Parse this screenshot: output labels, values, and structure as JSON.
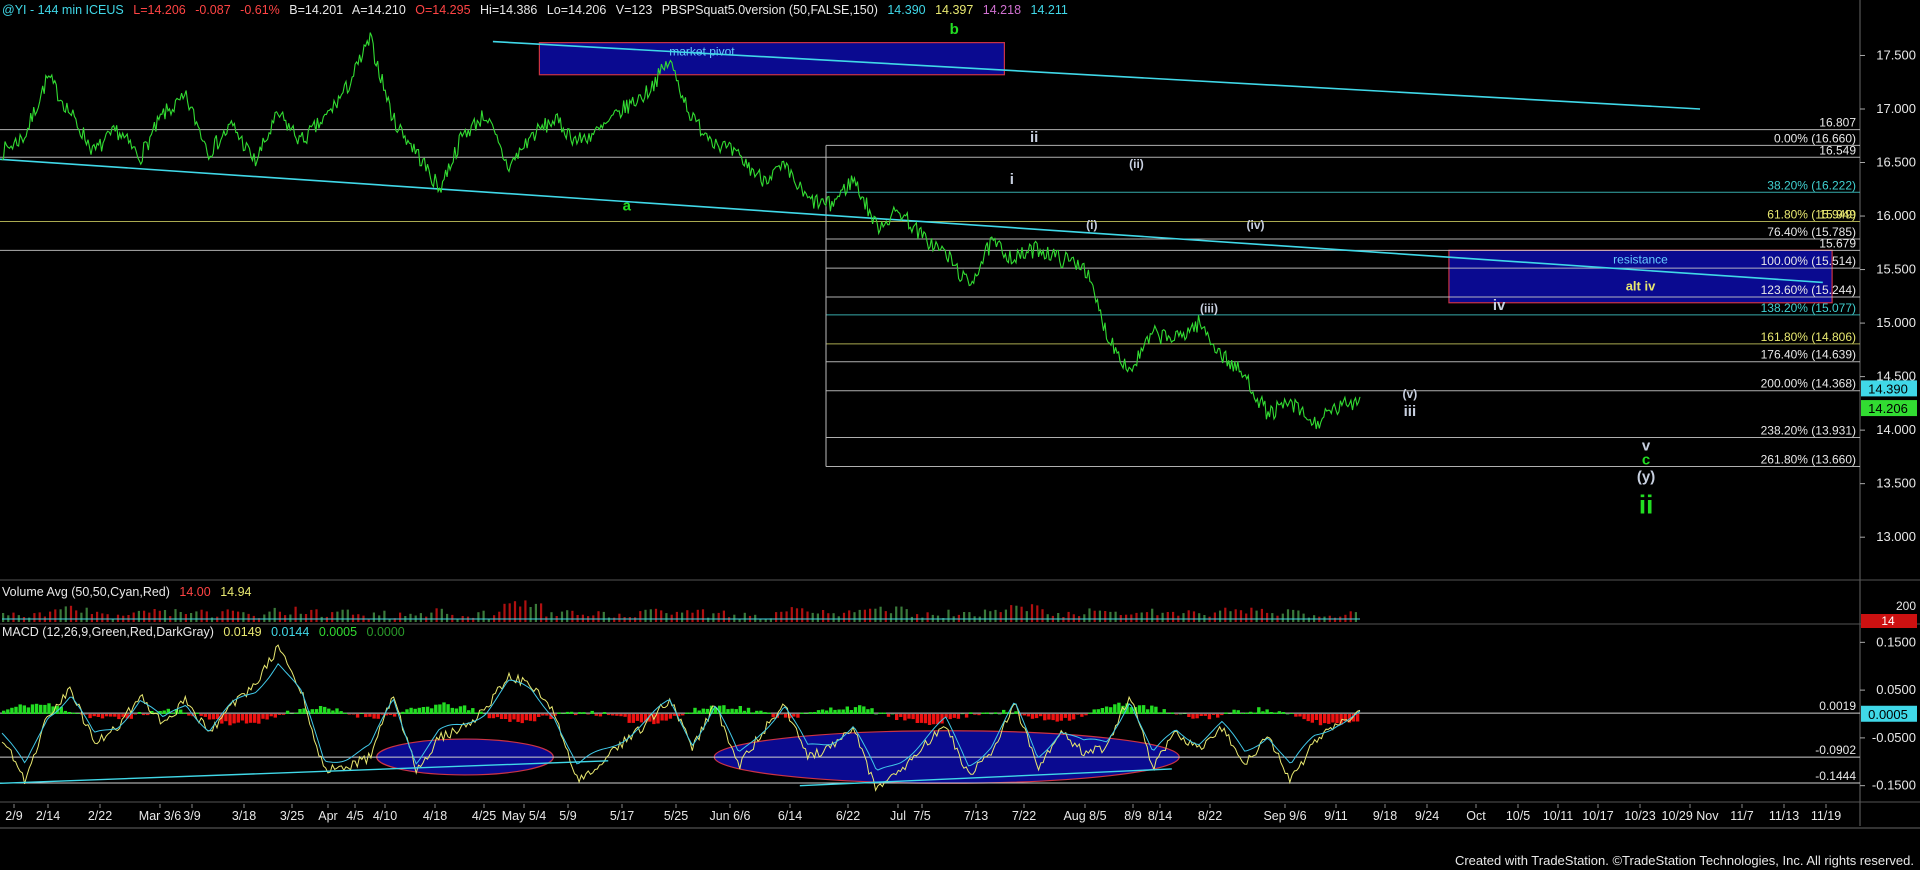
{
  "header": {
    "symbol": "@YI - 144 min ICEUS",
    "last": "L=14.206",
    "change": "-0.087",
    "pct": "-0.61%",
    "bid": "B=14.201",
    "ask": "A=14.210",
    "open": "O=14.295",
    "high": "Hi=14.386",
    "low": "Lo=14.206",
    "vol": "V=123",
    "study": "PBSPSquat5.0version (50,FALSE,150)",
    "v1": "14.390",
    "v2": "14.397",
    "v3": "14.218",
    "v4": "14.211"
  },
  "volume_label": {
    "name": "Volume Avg (50,50,Cyan,Red)",
    "a": "14.00",
    "b": "14.94"
  },
  "macd_label": {
    "name": "MACD (12,26,9,Green,Red,DarkGray)",
    "a": "0.0149",
    "b": "0.0144",
    "c": "0.0005",
    "d": "0.0000"
  },
  "footer": "Created with TradeStation. ©TradeStation Technologies, Inc. All rights reserved.",
  "colors": {
    "price": "#32dc32",
    "cyan": "#40d8e8",
    "box": "#0a0a90",
    "boxBorder": "#cc3344",
    "fib": "#ffffff",
    "fibGold": "#e8e870",
    "green": "#22dd22",
    "red": "#ee1111"
  },
  "chart_data": [
    {
      "type": "line",
      "title": "@YI - 144 min ICEUS",
      "ylim": [
        12.6,
        17.85
      ],
      "y_ticks": [
        "17.500",
        "17.000",
        "16.500",
        "16.000",
        "15.500",
        "15.000",
        "14.500",
        "14.000",
        "13.500",
        "13.000"
      ],
      "y_tick_values": [
        17.5,
        17.0,
        16.5,
        16.0,
        15.5,
        15.0,
        14.5,
        14.0,
        13.5,
        13.0
      ],
      "x_ticks": [
        "2/9",
        "2/14",
        "2/22",
        "Mar 3/6",
        "3/9",
        "3/18",
        "3/25",
        "Apr",
        "4/5",
        "4/10",
        "4/18",
        "4/25",
        "May 5/4",
        "5/9",
        "5/17",
        "5/25",
        "Jun 6/6",
        "6/14",
        "6/22",
        "Jul",
        "7/5",
        "7/13",
        "7/22",
        "Aug 8/5",
        "8/9",
        "8/14",
        "8/22",
        "Sep 9/6",
        "9/11",
        "9/18",
        "9/24",
        "Oct",
        "10/5",
        "10/11",
        "10/17",
        "10/23",
        "10/29 Nov",
        "11/7",
        "11/13",
        "11/19"
      ],
      "series": [
        {
          "values": [
            16.6,
            16.75,
            17.3,
            16.95,
            16.6,
            16.8,
            16.55,
            16.95,
            17.1,
            16.6,
            16.85,
            16.5,
            16.95,
            16.7,
            16.9,
            17.2,
            17.65,
            16.9,
            16.6,
            16.25,
            16.75,
            16.95,
            16.45,
            16.75,
            16.9,
            16.7,
            16.8,
            17.0,
            17.15,
            17.45,
            16.9,
            16.7,
            16.55,
            16.35,
            16.45,
            16.15,
            16.1,
            16.35,
            15.9,
            16.05,
            15.8,
            15.65,
            15.35,
            15.75,
            15.6,
            15.7,
            15.6,
            15.55,
            14.9,
            14.55,
            14.9,
            14.85,
            15.0,
            14.7,
            14.5,
            14.15,
            14.25,
            14.05,
            14.2,
            14.3
          ]
        }
      ],
      "fib_levels": [
        {
          "label": "16.807",
          "value": 16.807,
          "style": "white"
        },
        {
          "label": "0.00% (16.660)",
          "value": 16.66,
          "style": "white"
        },
        {
          "label": "16.549",
          "value": 16.549,
          "style": "white"
        },
        {
          "label": "38.20% (16.222)",
          "value": 16.222,
          "style": "cyan"
        },
        {
          "label": "61.80% (15.949)",
          "value": 15.949,
          "style": "gold"
        },
        {
          "label": "15.949",
          "value": 15.949,
          "style": "gold"
        },
        {
          "label": "76.40% (15.785)",
          "value": 15.785,
          "style": "white"
        },
        {
          "label": "15.679",
          "value": 15.679,
          "style": "white"
        },
        {
          "label": "100.00% (15.514)",
          "value": 15.514,
          "style": "white"
        },
        {
          "label": "123.60% (15.244)",
          "value": 15.244,
          "style": "white"
        },
        {
          "label": "138.20% (15.077)",
          "value": 15.077,
          "style": "cyan"
        },
        {
          "label": "161.80% (14.806)",
          "value": 14.806,
          "style": "gold"
        },
        {
          "label": "176.40% (14.639)",
          "value": 14.639,
          "style": "white"
        },
        {
          "label": "200.00% (14.368)",
          "value": 14.368,
          "style": "white"
        },
        {
          "label": "238.20% (13.931)",
          "value": 13.931,
          "style": "white"
        },
        {
          "label": "261.80% (13.660)",
          "value": 13.66,
          "style": "white"
        }
      ],
      "price_tags": [
        {
          "label": "14.390",
          "value": 14.39,
          "color": "#40d8e8"
        },
        {
          "label": "14.206",
          "value": 14.206,
          "color": "#32dc32"
        }
      ],
      "boxes": [
        {
          "label": "market pivot",
          "x0": 0.29,
          "x1": 0.54,
          "y0": 17.32,
          "y1": 17.62
        },
        {
          "label": "resistance",
          "label2": "alt iv",
          "x0": 0.779,
          "x1": 0.985,
          "y0": 15.19,
          "y1": 15.68
        }
      ],
      "trendlines": [
        {
          "x0": 0.0,
          "y0": 16.53,
          "x1": 0.98,
          "y1": 15.38
        },
        {
          "x0": 0.265,
          "y0": 17.63,
          "x1": 0.914,
          "y1": 17.0
        }
      ],
      "wave_labels": [
        {
          "text": "a",
          "x": 0.337,
          "y": 16.05,
          "color": "green",
          "size": "m"
        },
        {
          "text": "b",
          "x": 0.513,
          "y": 17.7,
          "color": "green",
          "size": "m"
        },
        {
          "text": "ii",
          "x": 0.556,
          "y": 16.69,
          "color": "grey",
          "size": "m"
        },
        {
          "text": "i",
          "x": 0.544,
          "y": 16.3,
          "color": "grey",
          "size": "m"
        },
        {
          "text": "(ii)",
          "x": 0.611,
          "y": 16.45,
          "color": "grey",
          "size": "s"
        },
        {
          "text": "(i)",
          "x": 0.587,
          "y": 15.88,
          "color": "grey",
          "size": "s"
        },
        {
          "text": "(iv)",
          "x": 0.675,
          "y": 15.88,
          "color": "grey",
          "size": "s"
        },
        {
          "text": "(iii)",
          "x": 0.65,
          "y": 15.1,
          "color": "grey",
          "size": "s"
        },
        {
          "text": "iv",
          "x": 0.806,
          "y": 15.12,
          "color": "grey",
          "size": "m"
        },
        {
          "text": "(v)",
          "x": 0.758,
          "y": 14.3,
          "color": "grey",
          "size": "s"
        },
        {
          "text": "iii",
          "x": 0.758,
          "y": 14.13,
          "color": "grey",
          "size": "m"
        },
        {
          "text": "v",
          "x": 0.885,
          "y": 13.81,
          "color": "grey",
          "size": "m"
        },
        {
          "text": "c",
          "x": 0.885,
          "y": 13.68,
          "color": "green",
          "size": "m"
        },
        {
          "text": "(y)",
          "x": 0.885,
          "y": 13.52,
          "color": "grey",
          "size": "m"
        },
        {
          "text": "ii",
          "x": 0.885,
          "y": 13.22,
          "color": "green",
          "size": "l"
        }
      ]
    },
    {
      "type": "bar",
      "title": "Volume Avg (50,50,Cyan,Red)",
      "y_ticks": [
        "200",
        "14"
      ],
      "values": [
        0.2,
        0.6,
        0.2,
        0.4,
        0.3,
        0.2,
        0.5,
        0.3,
        0.2,
        0.4,
        0.2,
        1,
        0.3,
        0.2,
        0.4,
        0.3,
        0.2,
        0.5,
        0.4,
        0.6,
        0.3,
        0.4,
        0.7,
        0.3,
        0.5,
        0.4,
        0.3,
        0.6,
        0.3,
        0.2
      ]
    },
    {
      "type": "line",
      "title": "MACD (12,26,9,Green,Red,DarkGray)",
      "ylim": [
        -0.18,
        0.18
      ],
      "y_ticks": [
        "0.1500",
        "0.0500",
        "-0.0500",
        "-0.1500"
      ],
      "y_tick_values": [
        0.15,
        0.05,
        -0.05,
        -0.15
      ],
      "levels": [
        {
          "label": "0.0019",
          "value": 0.0019
        },
        {
          "label": "-0.0902",
          "value": -0.0902
        },
        {
          "label": "-0.1444",
          "value": -0.1444
        }
      ],
      "current": {
        "label": "0.0005",
        "value": 0.0005
      },
      "macd": [
        -0.05,
        -0.14,
        0.0,
        0.05,
        -0.06,
        -0.03,
        0.04,
        -0.02,
        0.03,
        -0.04,
        0.02,
        0.06,
        0.14,
        0.05,
        -0.12,
        -0.11,
        -0.09,
        0.04,
        -0.12,
        -0.05,
        -0.03,
        0.01,
        0.08,
        0.06,
        0.0,
        -0.14,
        -0.1,
        -0.06,
        -0.02,
        0.03,
        -0.07,
        0.02,
        -0.11,
        -0.04,
        0.02,
        -0.09,
        -0.07,
        -0.03,
        -0.16,
        -0.12,
        -0.07,
        -0.02,
        -0.13,
        -0.08,
        0.02,
        -0.11,
        -0.04,
        -0.08,
        -0.07,
        0.04,
        -0.11,
        -0.04,
        -0.07,
        -0.03,
        -0.1,
        -0.05,
        -0.14,
        -0.06,
        -0.02,
        0.0
      ],
      "ellipses": [
        {
          "cx": 0.25,
          "w": 0.095,
          "cy": -0.09,
          "h": 0.075
        },
        {
          "cx": 0.509,
          "w": 0.25,
          "cy": -0.09,
          "h": 0.11
        }
      ]
    }
  ]
}
